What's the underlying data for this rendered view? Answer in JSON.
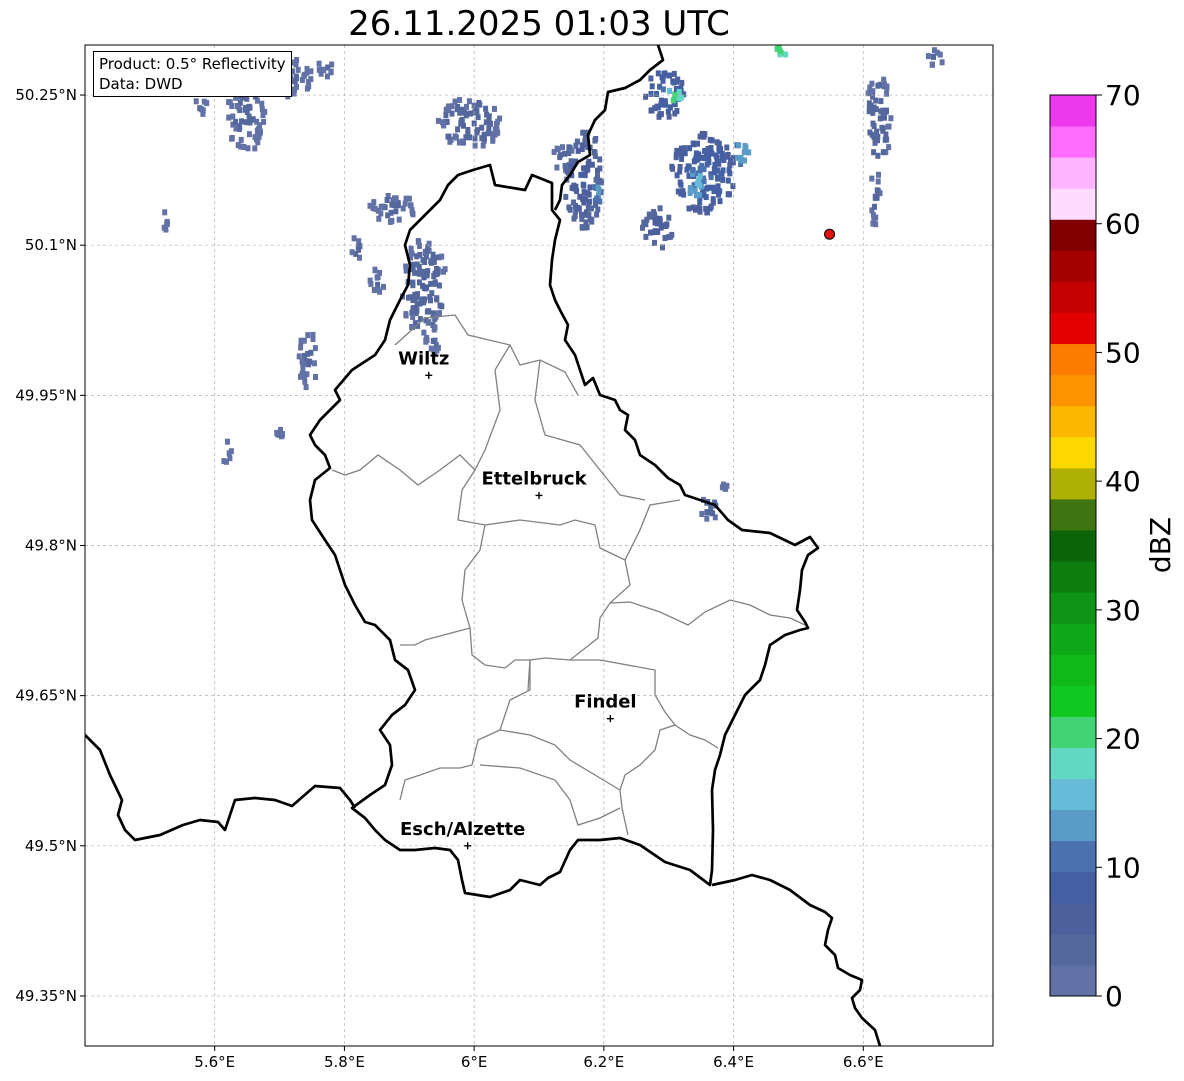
{
  "title": "26.11.2025 01:03 UTC",
  "info": {
    "product": "Product: 0.5° Reflectivity",
    "data_source": "Data: DWD"
  },
  "map": {
    "lon_range": [
      5.4,
      6.8
    ],
    "lat_range": [
      49.3,
      50.3
    ],
    "lon_ticks": [
      {
        "value": 5.6,
        "label": "5.6°E"
      },
      {
        "value": 5.8,
        "label": "5.8°E"
      },
      {
        "value": 6.0,
        "label": "6°E"
      },
      {
        "value": 6.2,
        "label": "6.2°E"
      },
      {
        "value": 6.4,
        "label": "6.4°E"
      },
      {
        "value": 6.6,
        "label": "6.6°E"
      }
    ],
    "lat_ticks": [
      {
        "value": 50.25,
        "label": "50.25°N"
      },
      {
        "value": 50.1,
        "label": "50.1°N"
      },
      {
        "value": 49.95,
        "label": "49.95°N"
      },
      {
        "value": 49.8,
        "label": "49.8°N"
      },
      {
        "value": 49.65,
        "label": "49.65°N"
      },
      {
        "value": 49.5,
        "label": "49.5°N"
      },
      {
        "value": 49.35,
        "label": "49.35°N"
      }
    ],
    "cities": [
      {
        "name": "Wiltz",
        "lon": 5.93,
        "lat": 49.97
      },
      {
        "name": "Ettelbruck",
        "lon": 6.1,
        "lat": 49.85
      },
      {
        "name": "Findel",
        "lon": 6.21,
        "lat": 49.627
      },
      {
        "name": "Esch/Alzette",
        "lon": 5.99,
        "lat": 49.5
      }
    ],
    "radar_site": {
      "lon": 6.548,
      "lat": 50.111,
      "color": "#e01010"
    },
    "precip_cells": [
      {
        "lon": 5.645,
        "lat": 50.235,
        "rlon": 0.03,
        "rlat": 0.04,
        "dbz": 4
      },
      {
        "lon": 5.72,
        "lat": 50.27,
        "rlon": 0.03,
        "rlat": 0.02,
        "dbz": 3
      },
      {
        "lon": 5.77,
        "lat": 50.28,
        "rlon": 0.015,
        "rlat": 0.01,
        "dbz": 3
      },
      {
        "lon": 5.52,
        "lat": 50.13,
        "rlon": 0.004,
        "rlat": 0.012,
        "dbz": 3
      },
      {
        "lon": 5.575,
        "lat": 50.245,
        "rlon": 0.01,
        "rlat": 0.012,
        "dbz": 3
      },
      {
        "lon": 5.87,
        "lat": 50.14,
        "rlon": 0.035,
        "rlat": 0.015,
        "dbz": 4
      },
      {
        "lon": 5.815,
        "lat": 50.1,
        "rlon": 0.01,
        "rlat": 0.012,
        "dbz": 4
      },
      {
        "lon": 5.845,
        "lat": 50.065,
        "rlon": 0.012,
        "rlat": 0.015,
        "dbz": 3
      },
      {
        "lon": 5.92,
        "lat": 50.06,
        "rlon": 0.035,
        "rlat": 0.05,
        "dbz": 5
      },
      {
        "lon": 5.93,
        "lat": 50.005,
        "rlon": 0.015,
        "rlat": 0.012,
        "dbz": 4
      },
      {
        "lon": 5.74,
        "lat": 49.99,
        "rlon": 0.015,
        "rlat": 0.03,
        "dbz": 4
      },
      {
        "lon": 5.615,
        "lat": 49.895,
        "rlon": 0.008,
        "rlat": 0.012,
        "dbz": 3
      },
      {
        "lon": 5.695,
        "lat": 49.915,
        "rlon": 0.008,
        "rlat": 0.005,
        "dbz": 3
      },
      {
        "lon": 5.99,
        "lat": 50.225,
        "rlon": 0.05,
        "rlat": 0.025,
        "dbz": 5
      },
      {
        "lon": 6.135,
        "lat": 50.19,
        "rlon": 0.02,
        "rlat": 0.012,
        "dbz": 5
      },
      {
        "lon": 6.165,
        "lat": 50.17,
        "rlon": 0.03,
        "rlat": 0.05,
        "dbz": 7
      },
      {
        "lon": 6.19,
        "lat": 50.155,
        "rlon": 0.01,
        "rlat": 0.01,
        "dbz": 14
      },
      {
        "lon": 6.29,
        "lat": 50.255,
        "rlon": 0.03,
        "rlat": 0.025,
        "dbz": 10
      },
      {
        "lon": 6.305,
        "lat": 50.25,
        "rlon": 0.012,
        "rlat": 0.01,
        "dbz": 20
      },
      {
        "lon": 6.35,
        "lat": 50.175,
        "rlon": 0.05,
        "rlat": 0.04,
        "dbz": 10
      },
      {
        "lon": 6.34,
        "lat": 50.165,
        "rlon": 0.015,
        "rlat": 0.015,
        "dbz": 16
      },
      {
        "lon": 6.28,
        "lat": 50.12,
        "rlon": 0.025,
        "rlat": 0.02,
        "dbz": 7
      },
      {
        "lon": 6.41,
        "lat": 50.195,
        "rlon": 0.015,
        "rlat": 0.012,
        "dbz": 15
      },
      {
        "lon": 6.47,
        "lat": 50.297,
        "rlon": 0.012,
        "rlat": 0.005,
        "dbz": 22
      },
      {
        "lon": 6.62,
        "lat": 50.23,
        "rlon": 0.02,
        "rlat": 0.045,
        "dbz": 5
      },
      {
        "lon": 6.615,
        "lat": 50.15,
        "rlon": 0.008,
        "rlat": 0.03,
        "dbz": 4
      },
      {
        "lon": 6.705,
        "lat": 50.29,
        "rlon": 0.015,
        "rlat": 0.008,
        "dbz": 4
      },
      {
        "lon": 6.36,
        "lat": 49.84,
        "rlon": 0.015,
        "rlat": 0.012,
        "dbz": 5
      },
      {
        "lon": 6.382,
        "lat": 49.863,
        "rlon": 0.004,
        "rlat": 0.004,
        "dbz": 3
      }
    ]
  },
  "colorbar": {
    "label": "dBZ",
    "min": 0,
    "max": 70,
    "ticks": [
      0,
      10,
      20,
      30,
      40,
      50,
      60,
      70
    ],
    "colors": [
      "#6272a6",
      "#55689e",
      "#4d5f9c",
      "#4560a2",
      "#4a72af",
      "#5a9cc7",
      "#66bbd8",
      "#62d8c2",
      "#42d474",
      "#10c820",
      "#10b818",
      "#0fa818",
      "#0f9418",
      "#0d7d10",
      "#0b6408",
      "#3f7510",
      "#aeb005",
      "#fcd800",
      "#fcb800",
      "#fc9400",
      "#fc7c00",
      "#e40000",
      "#c40000",
      "#a40000",
      "#800000",
      "#ffdcff",
      "#ffb4ff",
      "#ff6cff",
      "#ee38ee"
    ]
  }
}
